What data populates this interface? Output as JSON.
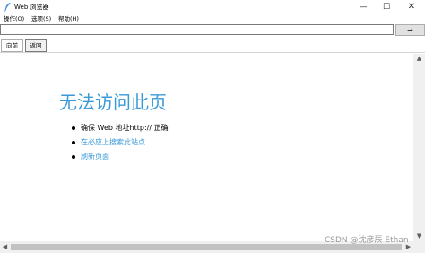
{
  "window": {
    "title": "Web 浏览器",
    "controls": {
      "minimize": "—",
      "maximize": "☐",
      "close": "✕"
    }
  },
  "menu": {
    "items": [
      "操作(O)",
      "选项(S)",
      "帮助(H)"
    ]
  },
  "address_bar": {
    "value": "",
    "go_label": "→"
  },
  "nav": {
    "back_label": "向前",
    "return_label": "返回"
  },
  "page": {
    "heading": "无法访问此页",
    "tips": [
      {
        "text": "确保 Web 地址http:// 正确",
        "is_link": false
      },
      {
        "text": "在必应上搜索此站点",
        "is_link": true
      },
      {
        "text": "刷新页面",
        "is_link": true
      }
    ]
  },
  "watermark": "CSDN @沈彦辰 Ethan",
  "icons": {
    "app": "browser-feather-icon",
    "scroll_up": "chevron-up-icon",
    "scroll_down": "chevron-down-icon",
    "scroll_left": "chevron-left-icon",
    "scroll_right": "chevron-right-icon"
  },
  "colors": {
    "heading": "#3a9ad9",
    "link": "#3a9ad9",
    "icon": "#4a90d9"
  }
}
